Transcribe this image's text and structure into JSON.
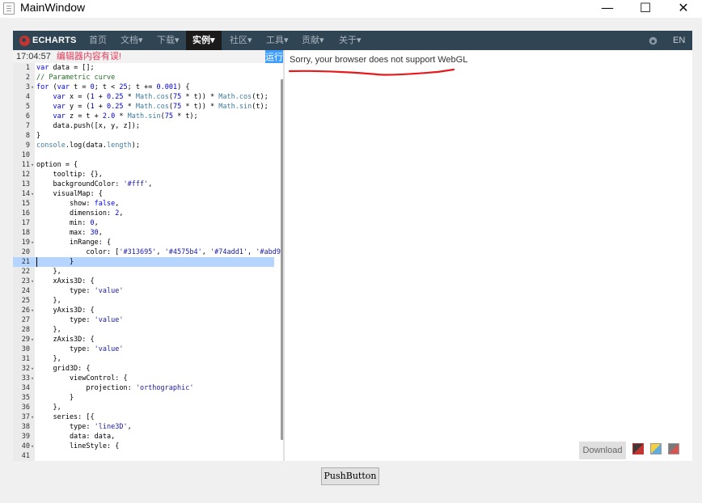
{
  "window": {
    "title": "MainWindow",
    "controls": {
      "minimize": "—",
      "maximize": "☐",
      "close": "✕"
    }
  },
  "navbar": {
    "logo_text": "ECHARTS",
    "items": [
      "首页",
      "文档▾",
      "下载▾",
      "实例▾",
      "社区▾",
      "工具▾",
      "贡献▾",
      "关于▾"
    ],
    "active_index": 3,
    "github_icon": "github-icon",
    "lang": "EN"
  },
  "editor": {
    "status_time": "17:04:57",
    "status_error": "编辑器内容有误!",
    "run_label": "运行",
    "active_line": 21,
    "lines": [
      {
        "n": "1",
        "f": false,
        "t": "var data = [];"
      },
      {
        "n": "2",
        "f": false,
        "t": "// Parametric curve"
      },
      {
        "n": "3",
        "f": true,
        "t": "for (var t = 0; t < 25; t += 0.001) {"
      },
      {
        "n": "4",
        "f": false,
        "t": "    var x = (1 + 0.25 * Math.cos(75 * t)) * Math.cos(t);"
      },
      {
        "n": "5",
        "f": false,
        "t": "    var y = (1 + 0.25 * Math.cos(75 * t)) * Math.sin(t);"
      },
      {
        "n": "6",
        "f": false,
        "t": "    var z = t + 2.0 * Math.sin(75 * t);"
      },
      {
        "n": "7",
        "f": false,
        "t": "    data.push([x, y, z]);"
      },
      {
        "n": "8",
        "f": false,
        "t": "}"
      },
      {
        "n": "9",
        "f": false,
        "t": "console.log(data.length);"
      },
      {
        "n": "10",
        "f": false,
        "t": ""
      },
      {
        "n": "11",
        "f": true,
        "t": "option = {"
      },
      {
        "n": "12",
        "f": false,
        "t": "    tooltip: {},"
      },
      {
        "n": "13",
        "f": false,
        "t": "    backgroundColor: '#fff',"
      },
      {
        "n": "14",
        "f": true,
        "t": "    visualMap: {"
      },
      {
        "n": "15",
        "f": false,
        "t": "        show: false,"
      },
      {
        "n": "16",
        "f": false,
        "t": "        dimension: 2,"
      },
      {
        "n": "17",
        "f": false,
        "t": "        min: 0,"
      },
      {
        "n": "18",
        "f": false,
        "t": "        max: 30,"
      },
      {
        "n": "19",
        "f": true,
        "t": "        inRange: {"
      },
      {
        "n": "20",
        "f": false,
        "t": "            color: ['#313695', '#4575b4', '#74add1', '#abd9"
      },
      {
        "n": "21",
        "f": false,
        "t": "        }"
      },
      {
        "n": "22",
        "f": false,
        "t": "    },"
      },
      {
        "n": "23",
        "f": true,
        "t": "    xAxis3D: {"
      },
      {
        "n": "24",
        "f": false,
        "t": "        type: 'value'"
      },
      {
        "n": "25",
        "f": false,
        "t": "    },"
      },
      {
        "n": "26",
        "f": true,
        "t": "    yAxis3D: {"
      },
      {
        "n": "27",
        "f": false,
        "t": "        type: 'value'"
      },
      {
        "n": "28",
        "f": false,
        "t": "    },"
      },
      {
        "n": "29",
        "f": true,
        "t": "    zAxis3D: {"
      },
      {
        "n": "30",
        "f": false,
        "t": "        type: 'value'"
      },
      {
        "n": "31",
        "f": false,
        "t": "    },"
      },
      {
        "n": "32",
        "f": true,
        "t": "    grid3D: {"
      },
      {
        "n": "33",
        "f": true,
        "t": "        viewControl: {"
      },
      {
        "n": "34",
        "f": false,
        "t": "            projection: 'orthographic'"
      },
      {
        "n": "35",
        "f": false,
        "t": "        }"
      },
      {
        "n": "36",
        "f": false,
        "t": "    },"
      },
      {
        "n": "37",
        "f": true,
        "t": "    series: [{"
      },
      {
        "n": "38",
        "f": false,
        "t": "        type: 'line3D',"
      },
      {
        "n": "39",
        "f": false,
        "t": "        data: data,"
      },
      {
        "n": "40",
        "f": true,
        "t": "        lineStyle: {"
      },
      {
        "n": "41",
        "f": false,
        "t": ""
      }
    ]
  },
  "preview": {
    "message": "Sorry, your browser does not support WebGL",
    "annotation_color": "#e8191b",
    "download_label": "Download",
    "themes": [
      {
        "name": "theme-dark-icon",
        "colors": [
          "#3a3a3a",
          "#c23531"
        ]
      },
      {
        "name": "theme-vintage-icon",
        "colors": [
          "#f4d03f",
          "#5dade2"
        ]
      },
      {
        "name": "theme-macarons-icon",
        "colors": [
          "#7a7a7a",
          "#d9534f"
        ]
      }
    ]
  },
  "push_button_label": "PushButton"
}
